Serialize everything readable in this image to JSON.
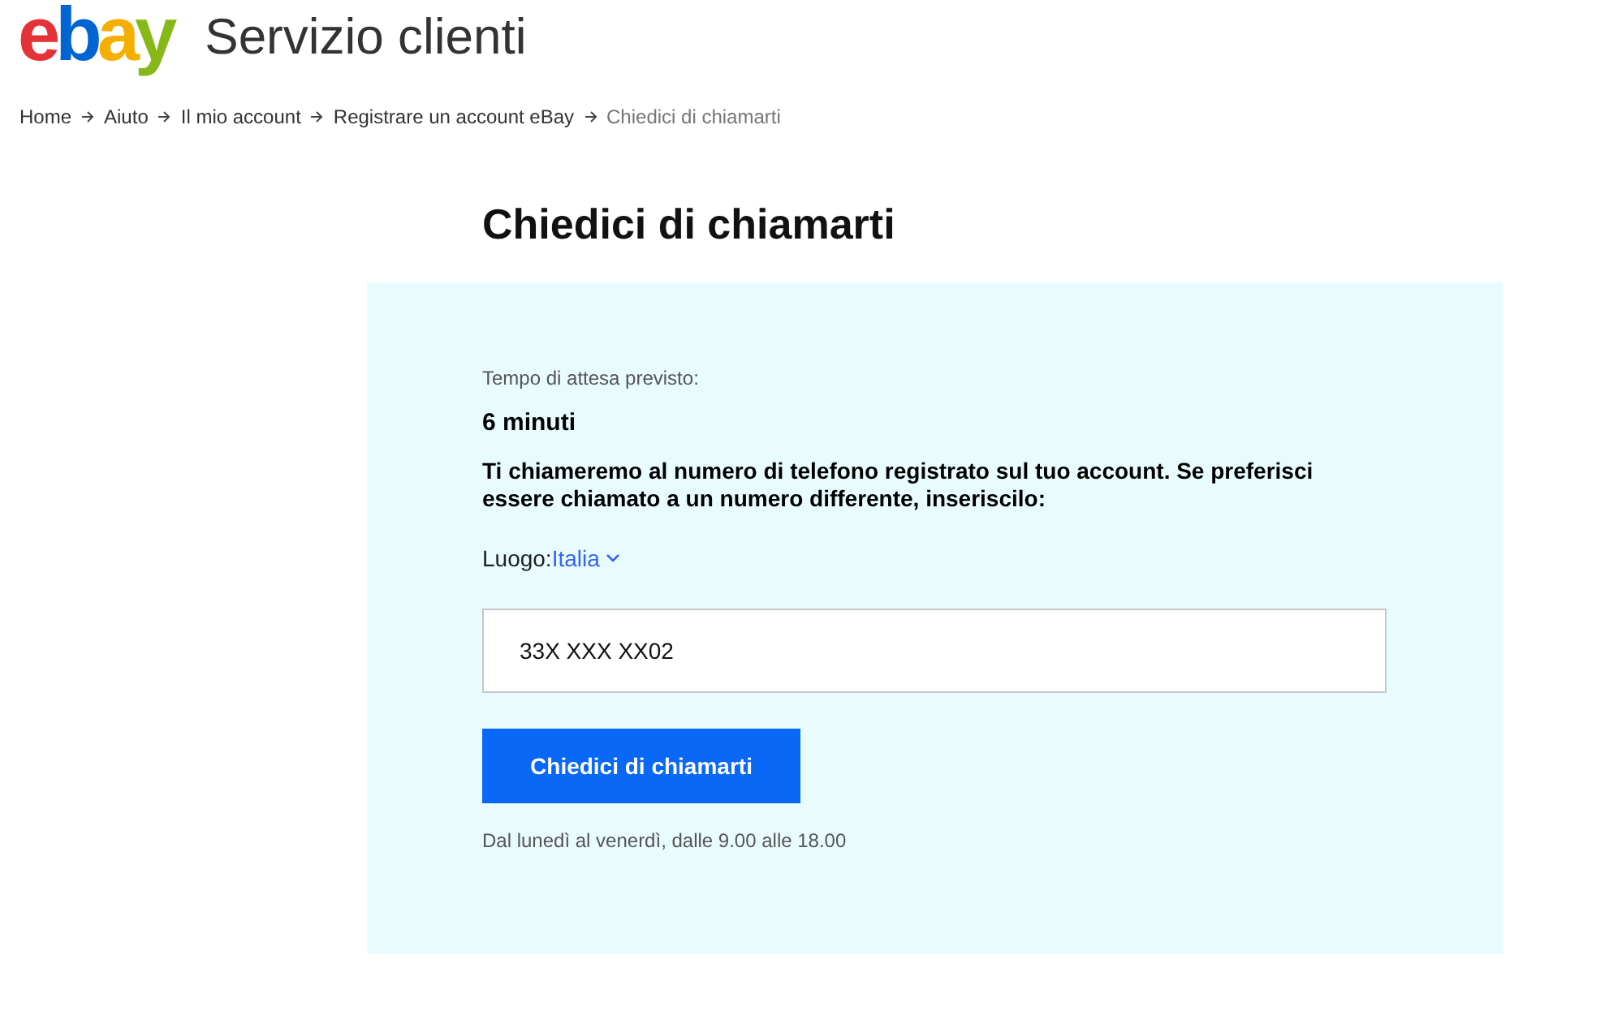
{
  "header": {
    "logo": [
      {
        "letter": "e",
        "color": "#e53238"
      },
      {
        "letter": "b",
        "color": "#0064d2"
      },
      {
        "letter": "a",
        "color": "#f5af02"
      },
      {
        "letter": "y",
        "color": "#86b817"
      }
    ],
    "title": "Servizio clienti"
  },
  "breadcrumb": [
    {
      "label": "Home",
      "current": false
    },
    {
      "label": "Aiuto",
      "current": false
    },
    {
      "label": "Il mio account",
      "current": false
    },
    {
      "label": "Registrare un account eBay",
      "current": false
    },
    {
      "label": "Chiedici di chiamarti",
      "current": true
    }
  ],
  "page_title": "Chiedici di chiamarti",
  "panel": {
    "wait_label": "Tempo di attesa previsto:",
    "wait_value": "6 minuti",
    "message": "Ti chiameremo al numero di telefono registrato sul tuo account. Se preferisci essere chiamato a un numero differente, inseriscilo:",
    "location_label": "Luogo:",
    "location_value": "Italia",
    "phone_value": "33X XXX XX02",
    "button": "Chiedici di chiamarti",
    "hours": "Dal lunedì al venerdì, dalle 9.00 alle 18.00"
  }
}
